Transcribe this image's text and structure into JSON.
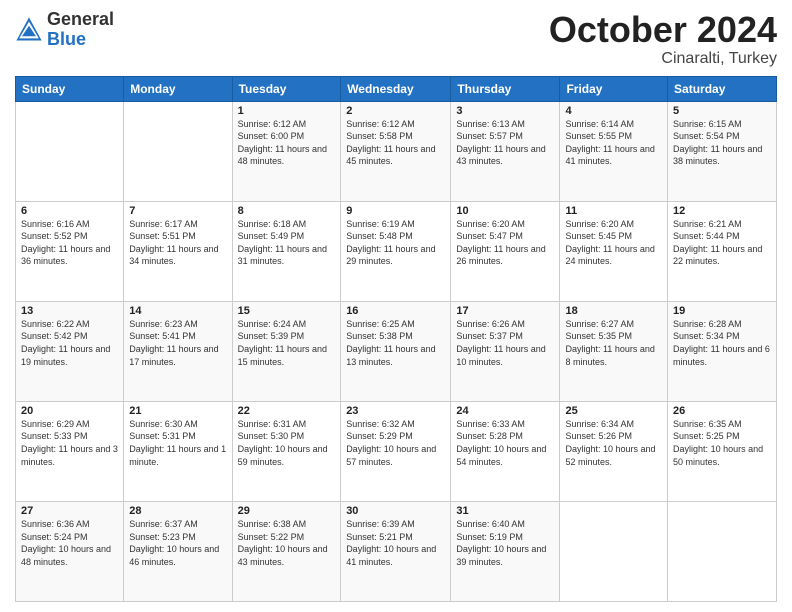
{
  "header": {
    "logo_general": "General",
    "logo_blue": "Blue",
    "month_title": "October 2024",
    "subtitle": "Cinaralti, Turkey"
  },
  "weekdays": [
    "Sunday",
    "Monday",
    "Tuesday",
    "Wednesday",
    "Thursday",
    "Friday",
    "Saturday"
  ],
  "weeks": [
    [
      {
        "day": "",
        "info": ""
      },
      {
        "day": "",
        "info": ""
      },
      {
        "day": "1",
        "info": "Sunrise: 6:12 AM\nSunset: 6:00 PM\nDaylight: 11 hours and 48 minutes."
      },
      {
        "day": "2",
        "info": "Sunrise: 6:12 AM\nSunset: 5:58 PM\nDaylight: 11 hours and 45 minutes."
      },
      {
        "day": "3",
        "info": "Sunrise: 6:13 AM\nSunset: 5:57 PM\nDaylight: 11 hours and 43 minutes."
      },
      {
        "day": "4",
        "info": "Sunrise: 6:14 AM\nSunset: 5:55 PM\nDaylight: 11 hours and 41 minutes."
      },
      {
        "day": "5",
        "info": "Sunrise: 6:15 AM\nSunset: 5:54 PM\nDaylight: 11 hours and 38 minutes."
      }
    ],
    [
      {
        "day": "6",
        "info": "Sunrise: 6:16 AM\nSunset: 5:52 PM\nDaylight: 11 hours and 36 minutes."
      },
      {
        "day": "7",
        "info": "Sunrise: 6:17 AM\nSunset: 5:51 PM\nDaylight: 11 hours and 34 minutes."
      },
      {
        "day": "8",
        "info": "Sunrise: 6:18 AM\nSunset: 5:49 PM\nDaylight: 11 hours and 31 minutes."
      },
      {
        "day": "9",
        "info": "Sunrise: 6:19 AM\nSunset: 5:48 PM\nDaylight: 11 hours and 29 minutes."
      },
      {
        "day": "10",
        "info": "Sunrise: 6:20 AM\nSunset: 5:47 PM\nDaylight: 11 hours and 26 minutes."
      },
      {
        "day": "11",
        "info": "Sunrise: 6:20 AM\nSunset: 5:45 PM\nDaylight: 11 hours and 24 minutes."
      },
      {
        "day": "12",
        "info": "Sunrise: 6:21 AM\nSunset: 5:44 PM\nDaylight: 11 hours and 22 minutes."
      }
    ],
    [
      {
        "day": "13",
        "info": "Sunrise: 6:22 AM\nSunset: 5:42 PM\nDaylight: 11 hours and 19 minutes."
      },
      {
        "day": "14",
        "info": "Sunrise: 6:23 AM\nSunset: 5:41 PM\nDaylight: 11 hours and 17 minutes."
      },
      {
        "day": "15",
        "info": "Sunrise: 6:24 AM\nSunset: 5:39 PM\nDaylight: 11 hours and 15 minutes."
      },
      {
        "day": "16",
        "info": "Sunrise: 6:25 AM\nSunset: 5:38 PM\nDaylight: 11 hours and 13 minutes."
      },
      {
        "day": "17",
        "info": "Sunrise: 6:26 AM\nSunset: 5:37 PM\nDaylight: 11 hours and 10 minutes."
      },
      {
        "day": "18",
        "info": "Sunrise: 6:27 AM\nSunset: 5:35 PM\nDaylight: 11 hours and 8 minutes."
      },
      {
        "day": "19",
        "info": "Sunrise: 6:28 AM\nSunset: 5:34 PM\nDaylight: 11 hours and 6 minutes."
      }
    ],
    [
      {
        "day": "20",
        "info": "Sunrise: 6:29 AM\nSunset: 5:33 PM\nDaylight: 11 hours and 3 minutes."
      },
      {
        "day": "21",
        "info": "Sunrise: 6:30 AM\nSunset: 5:31 PM\nDaylight: 11 hours and 1 minute."
      },
      {
        "day": "22",
        "info": "Sunrise: 6:31 AM\nSunset: 5:30 PM\nDaylight: 10 hours and 59 minutes."
      },
      {
        "day": "23",
        "info": "Sunrise: 6:32 AM\nSunset: 5:29 PM\nDaylight: 10 hours and 57 minutes."
      },
      {
        "day": "24",
        "info": "Sunrise: 6:33 AM\nSunset: 5:28 PM\nDaylight: 10 hours and 54 minutes."
      },
      {
        "day": "25",
        "info": "Sunrise: 6:34 AM\nSunset: 5:26 PM\nDaylight: 10 hours and 52 minutes."
      },
      {
        "day": "26",
        "info": "Sunrise: 6:35 AM\nSunset: 5:25 PM\nDaylight: 10 hours and 50 minutes."
      }
    ],
    [
      {
        "day": "27",
        "info": "Sunrise: 6:36 AM\nSunset: 5:24 PM\nDaylight: 10 hours and 48 minutes."
      },
      {
        "day": "28",
        "info": "Sunrise: 6:37 AM\nSunset: 5:23 PM\nDaylight: 10 hours and 46 minutes."
      },
      {
        "day": "29",
        "info": "Sunrise: 6:38 AM\nSunset: 5:22 PM\nDaylight: 10 hours and 43 minutes."
      },
      {
        "day": "30",
        "info": "Sunrise: 6:39 AM\nSunset: 5:21 PM\nDaylight: 10 hours and 41 minutes."
      },
      {
        "day": "31",
        "info": "Sunrise: 6:40 AM\nSunset: 5:19 PM\nDaylight: 10 hours and 39 minutes."
      },
      {
        "day": "",
        "info": ""
      },
      {
        "day": "",
        "info": ""
      }
    ]
  ]
}
